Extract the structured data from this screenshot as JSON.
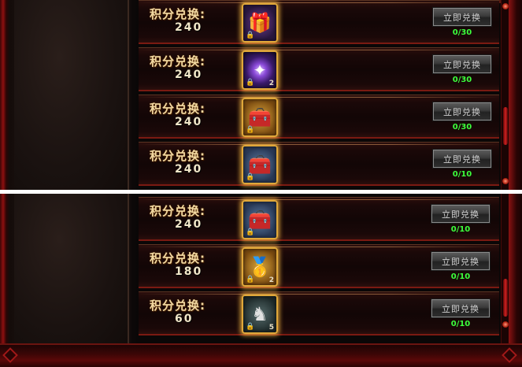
{
  "label": "积分兑换:",
  "button_label": "立即兑换",
  "top_panel": {
    "items": [
      {
        "points": "240",
        "icon": "purple-treasure-chest-icon",
        "count": "0/30"
      },
      {
        "points": "240",
        "icon": "purple-magic-orb-icon",
        "quantity": "2",
        "count": "0/30"
      },
      {
        "points": "240",
        "icon": "golden-treasure-chest-icon",
        "count": "0/30"
      },
      {
        "points": "240",
        "icon": "blue-treasure-chest-icon",
        "count": "0/10"
      }
    ]
  },
  "bottom_panel": {
    "items": [
      {
        "points": "240",
        "icon": "blue-treasure-chest-icon",
        "count": "0/10"
      },
      {
        "points": "180",
        "icon": "gold-ingot-icon",
        "quantity": "2",
        "count": "0/10"
      },
      {
        "points": "60",
        "icon": "horse-head-icon",
        "quantity": "5",
        "count": "0/10"
      }
    ]
  },
  "colors": {
    "accent_red": "#8e1010",
    "count_green": "#3cff3c",
    "label_gold": "#f2d9a2",
    "icon_border_gold": "#e0a83a"
  }
}
